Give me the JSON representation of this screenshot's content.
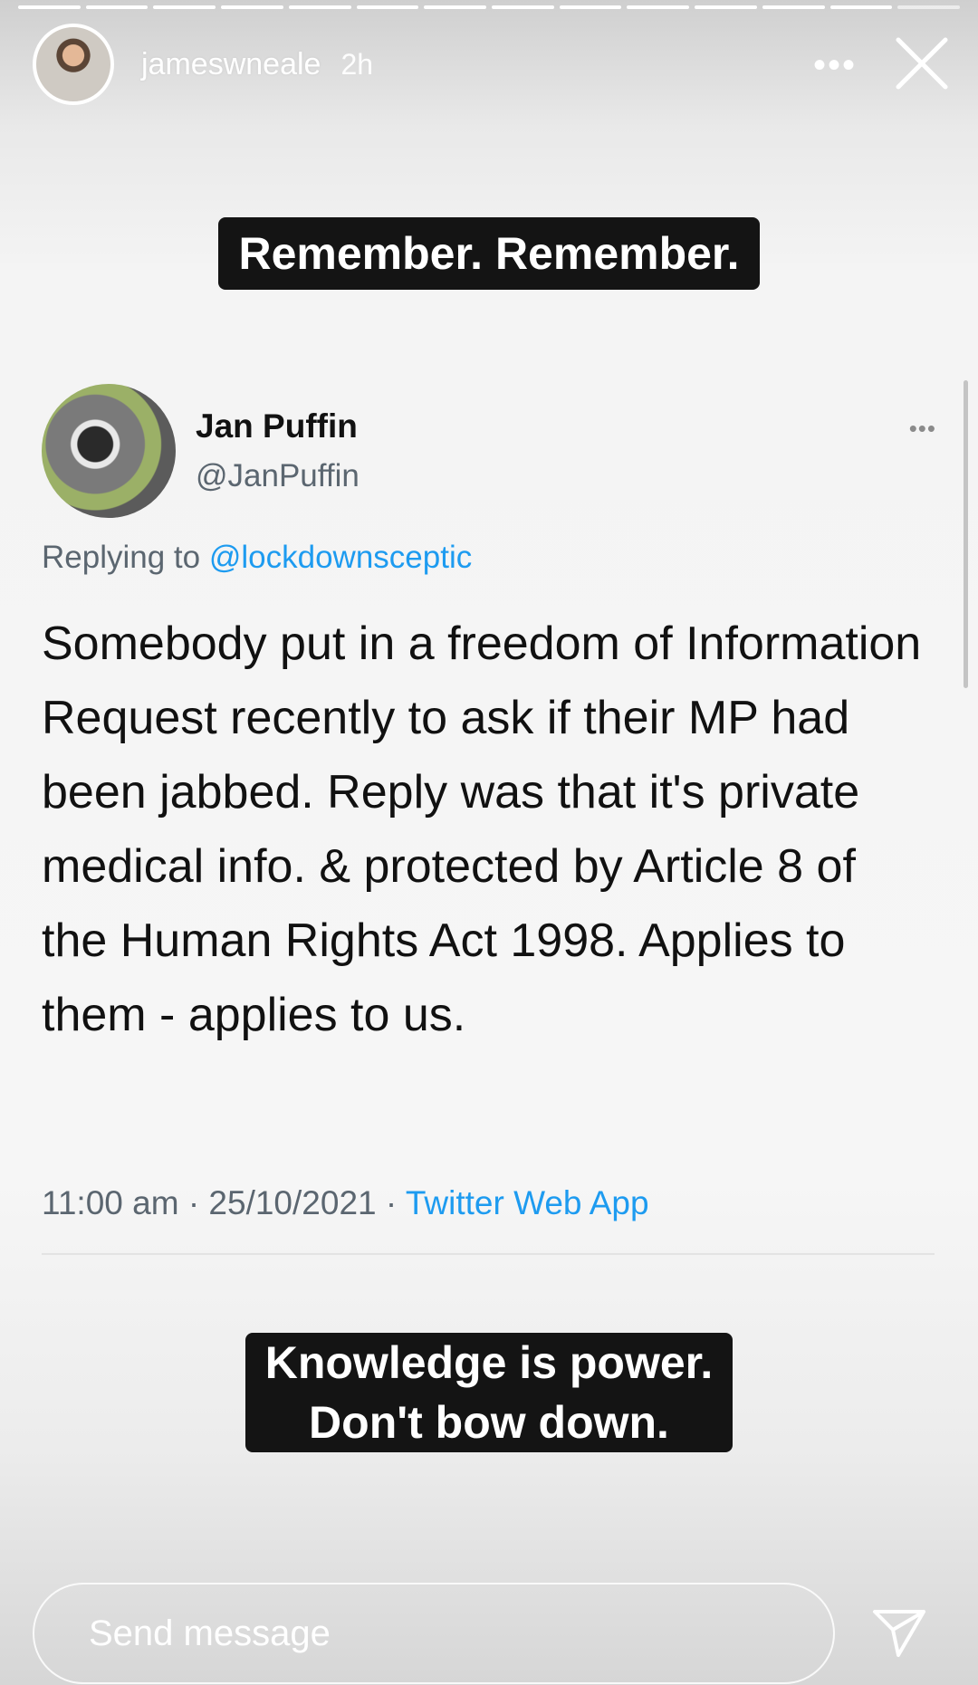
{
  "story": {
    "segments_total": 14,
    "segments_done": 13,
    "username": "jameswneale",
    "time_ago": "2h",
    "more_label": "•••"
  },
  "captions": {
    "top": "Remember. Remember.",
    "bottom_line1": "Knowledge is power.",
    "bottom_line2": "Don't bow down."
  },
  "tweet": {
    "name": "Jan Puffin",
    "handle": "@JanPuffin",
    "menu_label": "•••",
    "replying_prefix": "Replying to",
    "replying_to": "@lockdownsceptic",
    "body": "Somebody put in a freedom of Information Request recently to ask if their MP had been jabbed. Reply was that it's private medical info. & protected by Article 8 of the Human Rights Act 1998. Applies to them - applies to us.",
    "time": "11:00 am",
    "date": "25/10/2021",
    "source": "Twitter Web App",
    "separator": "·"
  },
  "reply": {
    "placeholder": "Send message"
  },
  "colors": {
    "caption_bg": "#141414",
    "link_blue": "#1d9bf0",
    "muted_gray": "#5b6670"
  }
}
